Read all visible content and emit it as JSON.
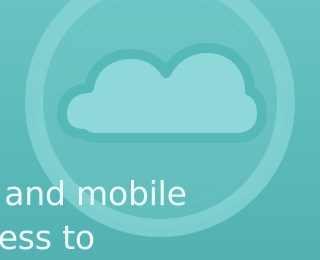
{
  "hero": {
    "caption": "c and mobile\ntless to",
    "icon": "cloud-icon",
    "colors": {
      "background": "#5cbcbb",
      "ring": "#7fcfd0",
      "cloud_fill": "#8ed8d9",
      "cloud_stroke": "#55b9b8",
      "caption": "#eefafa"
    }
  }
}
